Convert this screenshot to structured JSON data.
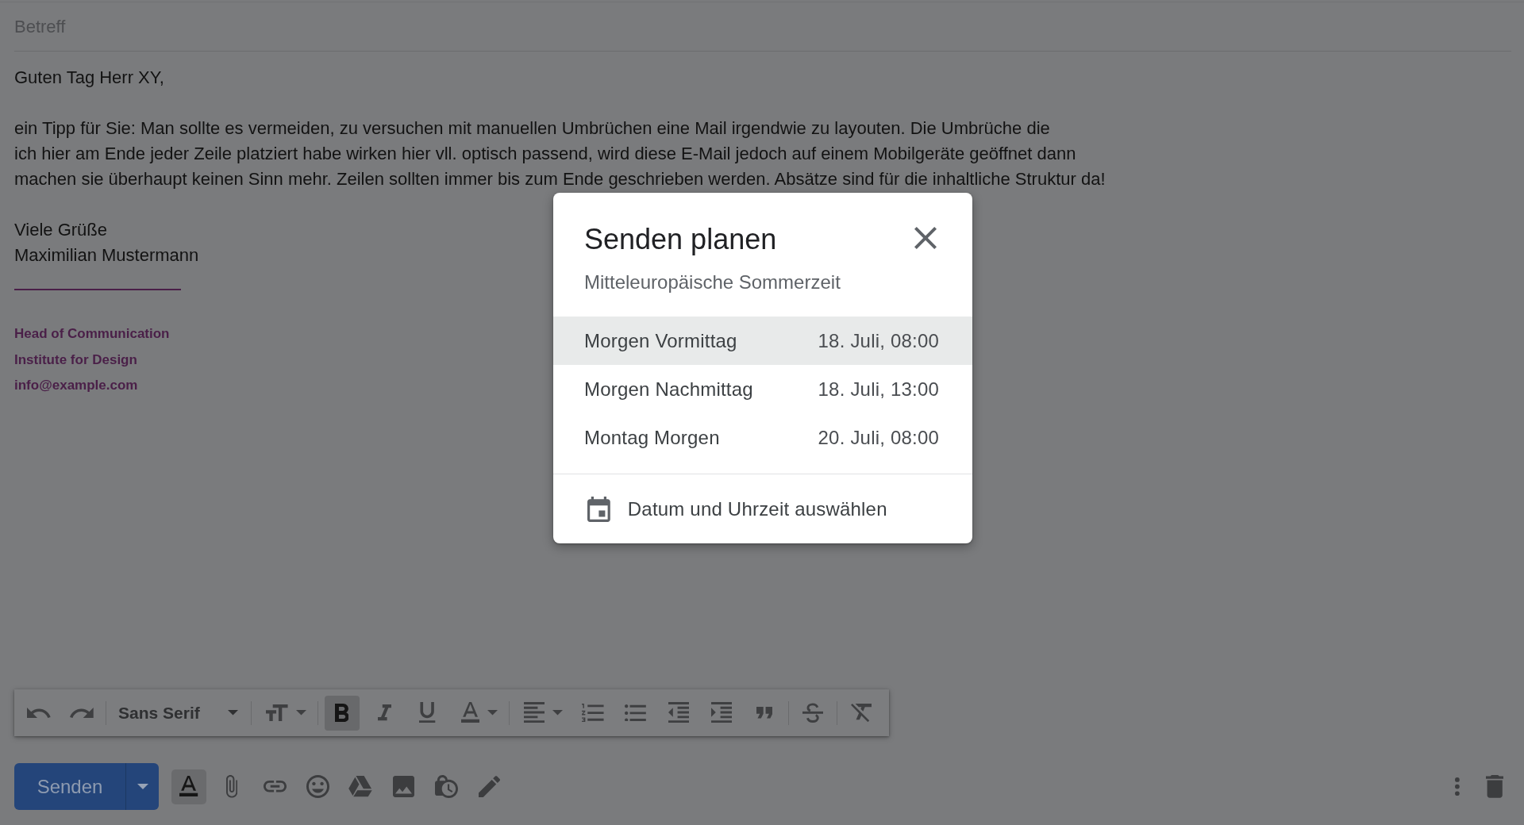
{
  "subject": {
    "placeholder": "Betreff"
  },
  "message": {
    "greeting": "Guten Tag Herr XY,",
    "paragraph_lines": [
      "ein Tipp für Sie: Man sollte es vermeiden, zu versuchen mit manuellen Umbrüchen eine Mail irgendwie zu layouten. Die Umbrüche die",
      "ich hier am Ende jeder Zeile platziert habe wirken hier vll. optisch passend, wird diese E-Mail jedoch auf einem Mobilgeräte geöffnet dann",
      "machen sie überhaupt keinen Sinn mehr. Zeilen sollten immer bis zum Ende geschrieben werden. Absätze sind für die inhaltliche Struktur da!"
    ],
    "closing": "Viele Grüße",
    "sender": "Maximilian Mustermann"
  },
  "signature": {
    "title": "Head of Communication",
    "organization": "Institute for Design",
    "email": "info@example.com"
  },
  "schedule_dialog": {
    "title": "Senden planen",
    "timezone": "Mitteleuropäische Sommerzeit",
    "options": [
      {
        "label": "Morgen Vormittag",
        "time": "18. Juli, 08:00",
        "selected": true
      },
      {
        "label": "Morgen Nachmittag",
        "time": "18. Juli, 13:00",
        "selected": false
      },
      {
        "label": "Montag Morgen",
        "time": "20. Juli, 08:00",
        "selected": false
      }
    ],
    "custom_option": {
      "label": "Datum und Uhrzeit auswählen"
    }
  },
  "format_toolbar": {
    "groups": [
      {
        "items": [
          {
            "kind": "undo",
            "active": false
          },
          {
            "kind": "redo",
            "active": false
          }
        ]
      },
      {
        "items": [
          {
            "kind": "font",
            "label": "Sans Serif",
            "active": false
          }
        ]
      },
      {
        "items": [
          {
            "kind": "text_size",
            "active": false
          }
        ]
      },
      {
        "items": [
          {
            "kind": "bold",
            "active": true
          },
          {
            "kind": "italic",
            "active": false
          },
          {
            "kind": "underline",
            "active": false
          },
          {
            "kind": "text_color",
            "active": false
          }
        ]
      },
      {
        "items": [
          {
            "kind": "align",
            "active": false
          },
          {
            "kind": "numbered_list",
            "active": false
          },
          {
            "kind": "bulleted_list",
            "active": false
          },
          {
            "kind": "indent_less",
            "active": false
          },
          {
            "kind": "indent_more",
            "active": false
          },
          {
            "kind": "quote",
            "active": false
          }
        ]
      },
      {
        "items": [
          {
            "kind": "strikethrough",
            "active": false
          }
        ]
      },
      {
        "items": [
          {
            "kind": "clear_format",
            "active": false
          }
        ]
      }
    ]
  },
  "bottom_bar": {
    "send": {
      "label": "Senden"
    },
    "tools": [
      {
        "kind": "formatting",
        "active": true
      },
      {
        "kind": "attach",
        "active": false
      },
      {
        "kind": "link",
        "active": false
      },
      {
        "kind": "emoji",
        "active": false
      },
      {
        "kind": "drive",
        "active": false
      },
      {
        "kind": "photo",
        "active": false
      },
      {
        "kind": "lock_clock",
        "active": false
      },
      {
        "kind": "signature",
        "active": false
      }
    ],
    "end_tools": [
      {
        "kind": "more"
      },
      {
        "kind": "discard"
      }
    ]
  }
}
